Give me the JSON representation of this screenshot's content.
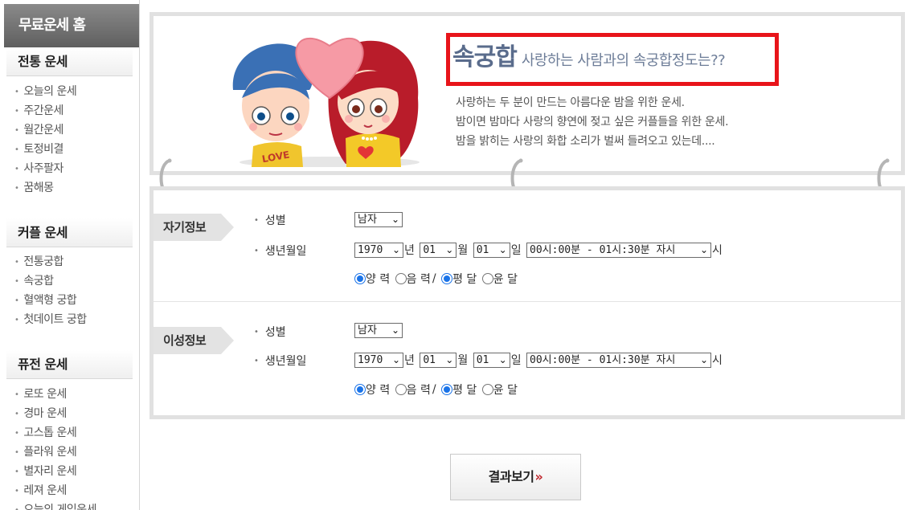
{
  "sidebar": {
    "home_label": "무료운세 홈",
    "sections": [
      {
        "title": "전통 운세",
        "items": [
          "오늘의 운세",
          "주간운세",
          "월간운세",
          "토정비결",
          "사주팔자",
          "꿈해몽"
        ]
      },
      {
        "title": "커플 운세",
        "items": [
          "전통궁합",
          "속궁합",
          "혈액형 궁합",
          "첫데이트 궁합"
        ]
      },
      {
        "title": "퓨전 운세",
        "items": [
          "로또 운세",
          "경마 운세",
          "고스톱 운세",
          "플라워 운세",
          "별자리 운세",
          "레져 운세",
          "오늘의 게임운세"
        ]
      }
    ]
  },
  "banner": {
    "title": "속궁합",
    "subtitle": "사랑하는 사람과의 속궁합정도는??",
    "desc": [
      "사랑하는 두 분이 만드는 아름다운 밤을 위한 운세.",
      "밤이면 밤마다 사랑의 향연에 젖고 싶은 커플들을 위한 운세.",
      "밤을 밝히는 사랑의 화합 소리가 벌써 들려오고 있는데...."
    ],
    "love_text": "LOVE",
    "colors": {
      "title": "#5a6c8c",
      "highlight_border": "#e8141a"
    }
  },
  "form": {
    "self": {
      "tag": "자기정보",
      "gender_label": "성별",
      "gender_value": "남자",
      "birth_label": "생년월일",
      "year": "1970",
      "year_unit": "년",
      "month": "01",
      "month_unit": "월",
      "day": "01",
      "day_unit": "일",
      "time": "00시:00분 - 01시:30분 자시",
      "time_unit": "시",
      "solar_label": "양 력",
      "lunar_label": "음 력",
      "sep": "/",
      "normal_label": "평 달",
      "leap_label": "윤 달",
      "calendar_selected": "양 력",
      "month_type_selected": "평 달"
    },
    "partner": {
      "tag": "이성정보",
      "gender_label": "성별",
      "gender_value": "남자",
      "birth_label": "생년월일",
      "year": "1970",
      "year_unit": "년",
      "month": "01",
      "month_unit": "월",
      "day": "01",
      "day_unit": "일",
      "time": "00시:00분 - 01시:30분 자시",
      "time_unit": "시",
      "solar_label": "양 력",
      "lunar_label": "음 력",
      "sep": "/",
      "normal_label": "평 달",
      "leap_label": "윤 달",
      "calendar_selected": "양 력",
      "month_type_selected": "평 달"
    }
  },
  "result_button": {
    "label": "결과보기",
    "arrow": "»",
    "arrow_color": "#c0282e"
  },
  "icons": {
    "select_chevron": "chevron-down-icon",
    "bullet": "bullet-icon"
  }
}
